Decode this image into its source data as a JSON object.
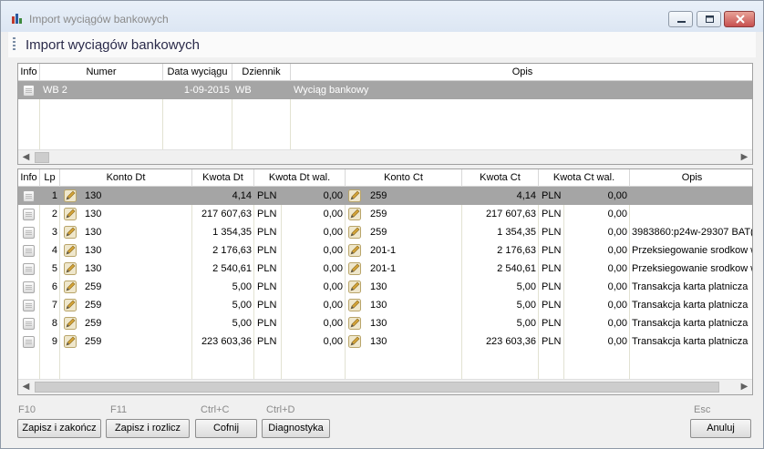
{
  "window": {
    "title": "Import wyciągów bankowych"
  },
  "header": {
    "title": "Import wyciągów bankowych"
  },
  "statements": {
    "columns": [
      "Info",
      "Numer",
      "Data wyciągu",
      "Dziennik",
      "Opis"
    ],
    "rows": [
      {
        "numer": "WB 2",
        "data": "1-09-2015",
        "dziennik": "WB",
        "opis": "Wyciąg bankowy",
        "selected": true
      }
    ]
  },
  "transactions": {
    "columns": [
      "Info",
      "Lp",
      "Konto Dt",
      "Kwota Dt",
      "Kwota Dt wal.",
      "Konto Ct",
      "Kwota Ct",
      "Kwota Ct wal.",
      "Opis"
    ],
    "rows": [
      {
        "lp": "1",
        "konto_dt": "130",
        "kwota_dt": "4,14",
        "waluta_dt": "PLN",
        "kwota_dt_wal": "0,00",
        "konto_ct": "259",
        "kwota_ct": "4,14",
        "waluta_ct": "PLN",
        "kwota_ct_wal": "0,00",
        "opis": "",
        "selected": true
      },
      {
        "lp": "2",
        "konto_dt": "130",
        "kwota_dt": "217 607,63",
        "waluta_dt": "PLN",
        "kwota_dt_wal": "0,00",
        "konto_ct": "259",
        "kwota_ct": "217 607,63",
        "waluta_ct": "PLN",
        "kwota_ct_wal": "0,00",
        "opis": ""
      },
      {
        "lp": "3",
        "konto_dt": "130",
        "kwota_dt": "1 354,35",
        "waluta_dt": "PLN",
        "kwota_dt_wal": "0,00",
        "konto_ct": "259",
        "kwota_ct": "1 354,35",
        "waluta_ct": "PLN",
        "kwota_ct_wal": "0,00",
        "opis": "3983860:p24w-29307 BAT("
      },
      {
        "lp": "4",
        "konto_dt": "130",
        "kwota_dt": "2 176,63",
        "waluta_dt": "PLN",
        "kwota_dt_wal": "0,00",
        "konto_ct": "201-1",
        "kwota_ct": "2 176,63",
        "waluta_ct": "PLN",
        "kwota_ct_wal": "0,00",
        "opis": "Przeksiegowanie srodkow w"
      },
      {
        "lp": "5",
        "konto_dt": "130",
        "kwota_dt": "2 540,61",
        "waluta_dt": "PLN",
        "kwota_dt_wal": "0,00",
        "konto_ct": "201-1",
        "kwota_ct": "2 540,61",
        "waluta_ct": "PLN",
        "kwota_ct_wal": "0,00",
        "opis": "Przeksiegowanie srodkow w"
      },
      {
        "lp": "6",
        "konto_dt": "259",
        "kwota_dt": "5,00",
        "waluta_dt": "PLN",
        "kwota_dt_wal": "0,00",
        "konto_ct": "130",
        "kwota_ct": "5,00",
        "waluta_ct": "PLN",
        "kwota_ct_wal": "0,00",
        "opis": "Transakcja karta platnicza"
      },
      {
        "lp": "7",
        "konto_dt": "259",
        "kwota_dt": "5,00",
        "waluta_dt": "PLN",
        "kwota_dt_wal": "0,00",
        "konto_ct": "130",
        "kwota_ct": "5,00",
        "waluta_ct": "PLN",
        "kwota_ct_wal": "0,00",
        "opis": "Transakcja karta platnicza"
      },
      {
        "lp": "8",
        "konto_dt": "259",
        "kwota_dt": "5,00",
        "waluta_dt": "PLN",
        "kwota_dt_wal": "0,00",
        "konto_ct": "130",
        "kwota_ct": "5,00",
        "waluta_ct": "PLN",
        "kwota_ct_wal": "0,00",
        "opis": "Transakcja karta platnicza"
      },
      {
        "lp": "9",
        "konto_dt": "259",
        "kwota_dt": "223 603,36",
        "waluta_dt": "PLN",
        "kwota_dt_wal": "0,00",
        "konto_ct": "130",
        "kwota_ct": "223 603,36",
        "waluta_ct": "PLN",
        "kwota_ct_wal": "0,00",
        "opis": "Transakcja karta platnicza"
      }
    ]
  },
  "footer": {
    "save_close": {
      "key": "F10",
      "label": "Zapisz i zakończ"
    },
    "save_settle": {
      "key": "F11",
      "label": "Zapisz i rozlicz"
    },
    "undo": {
      "key": "Ctrl+C",
      "label": "Cofnij"
    },
    "diagnostics": {
      "key": "Ctrl+D",
      "label": "Diagnostyka"
    },
    "cancel": {
      "key": "Esc",
      "label": "Anuluj"
    }
  },
  "colors": {
    "selected_row": "#a5a5a5",
    "title_text": "#8a8a8a"
  },
  "icons": [
    "app-icon",
    "minimize-icon",
    "maximize-icon",
    "close-icon",
    "info-icon",
    "pencil-icon",
    "chevron-left-icon",
    "chevron-right-icon"
  ]
}
